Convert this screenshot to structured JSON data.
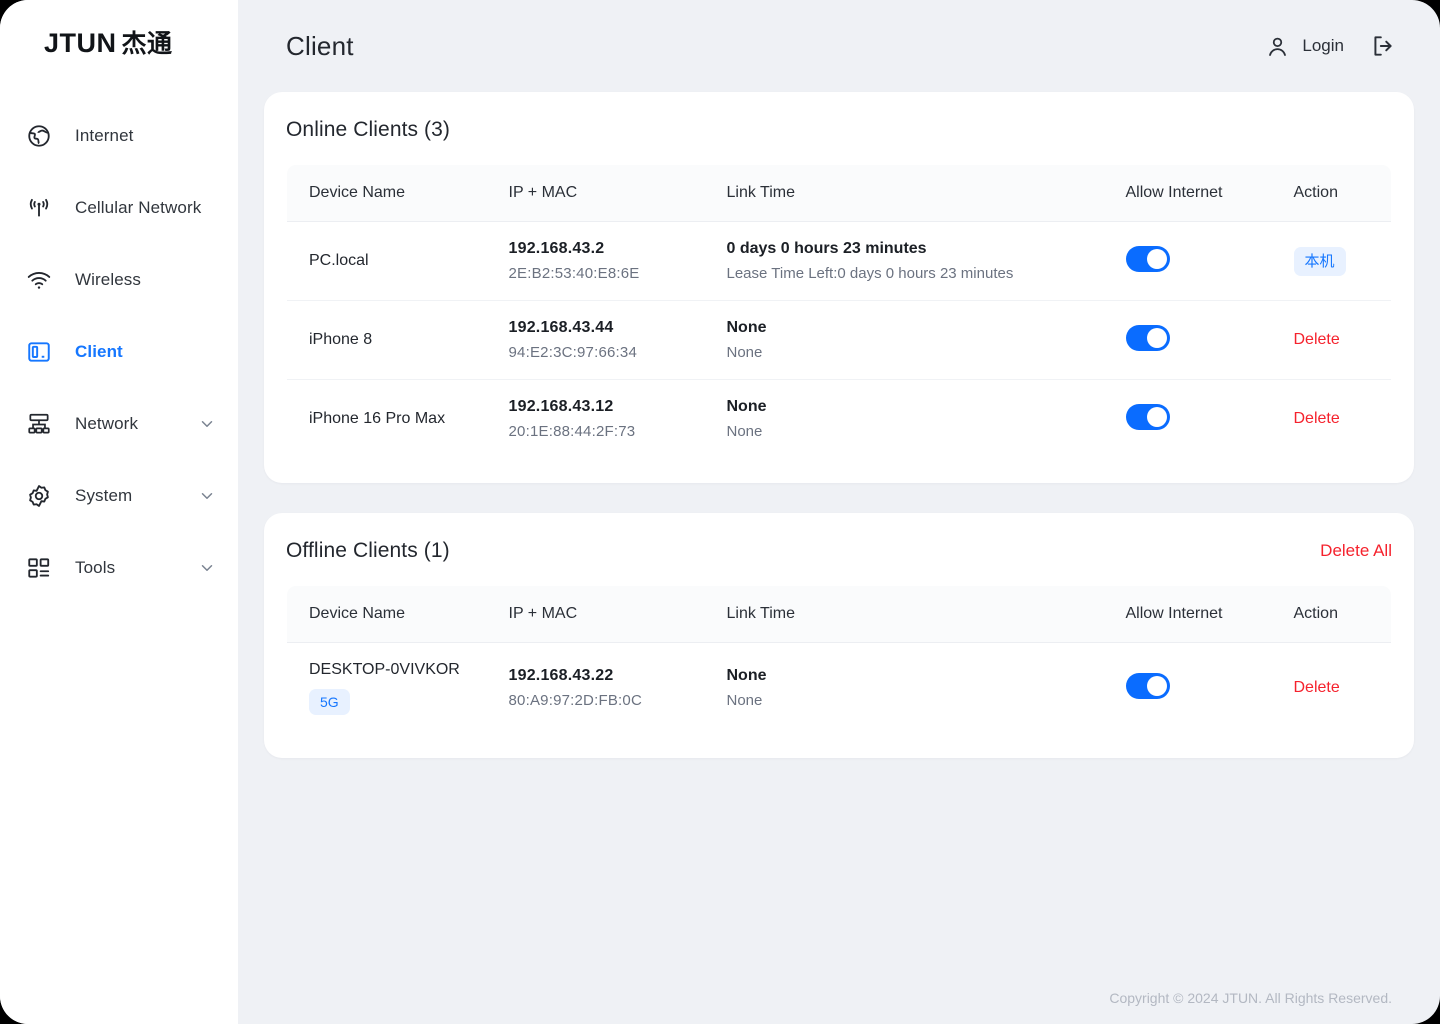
{
  "brand": {
    "name": "JTUN",
    "cn": "杰通"
  },
  "header": {
    "title": "Client",
    "login_label": "Login",
    "user_icon": "user-icon",
    "logout_icon": "logout-icon"
  },
  "sidebar": {
    "items": [
      {
        "label": "Internet",
        "icon": "globe-icon",
        "active": false,
        "expandable": false
      },
      {
        "label": "Cellular Network",
        "icon": "antenna-icon",
        "active": false,
        "expandable": false
      },
      {
        "label": "Wireless",
        "icon": "wifi-icon",
        "active": false,
        "expandable": false
      },
      {
        "label": "Client",
        "icon": "devices-icon",
        "active": true,
        "expandable": false
      },
      {
        "label": "Network",
        "icon": "sitemap-icon",
        "active": false,
        "expandable": true
      },
      {
        "label": "System",
        "icon": "gear-icon",
        "active": false,
        "expandable": true
      },
      {
        "label": "Tools",
        "icon": "grid-icon",
        "active": false,
        "expandable": true
      }
    ]
  },
  "online": {
    "title": "Online Clients (3)",
    "columns": [
      "Device Name",
      "IP + MAC",
      "Link Time",
      "Allow Internet",
      "Action"
    ],
    "rows": [
      {
        "device": "PC.local",
        "device_badge": null,
        "ip": "192.168.43.2",
        "mac": "2E:B2:53:40:E8:6E",
        "link_time": "0 days 0 hours 23 minutes",
        "link_sub": "Lease Time Left:0 days 0 hours 23 minutes",
        "allow_internet": true,
        "action_type": "badge",
        "action_label": "本机"
      },
      {
        "device": "iPhone 8",
        "device_badge": null,
        "ip": "192.168.43.44",
        "mac": "94:E2:3C:97:66:34",
        "link_time": "None",
        "link_sub": "None",
        "allow_internet": true,
        "action_type": "delete",
        "action_label": "Delete"
      },
      {
        "device": "iPhone 16 Pro Max",
        "device_badge": null,
        "ip": "192.168.43.12",
        "mac": "20:1E:88:44:2F:73",
        "link_time": "None",
        "link_sub": "None",
        "allow_internet": true,
        "action_type": "delete",
        "action_label": "Delete"
      }
    ]
  },
  "offline": {
    "title": "Offline Clients (1)",
    "delete_all_label": "Delete All",
    "columns": [
      "Device Name",
      "IP + MAC",
      "Link Time",
      "Allow Internet",
      "Action"
    ],
    "rows": [
      {
        "device": "DESKTOP-0VIVKOR",
        "device_badge": "5G",
        "ip": "192.168.43.22",
        "mac": "80:A9:97:2D:FB:0C",
        "link_time": "None",
        "link_sub": "None",
        "allow_internet": true,
        "action_type": "delete",
        "action_label": "Delete"
      }
    ]
  },
  "footer": {
    "copyright": "Copyright © 2024 JTUN. All Rights Reserved."
  },
  "colors": {
    "accent": "#1677ff",
    "toggle_on": "#0a6cff",
    "danger": "#f5222d",
    "badge_bg": "#e8f1ff",
    "page_bg": "#eff1f5",
    "card_bg": "#ffffff"
  }
}
